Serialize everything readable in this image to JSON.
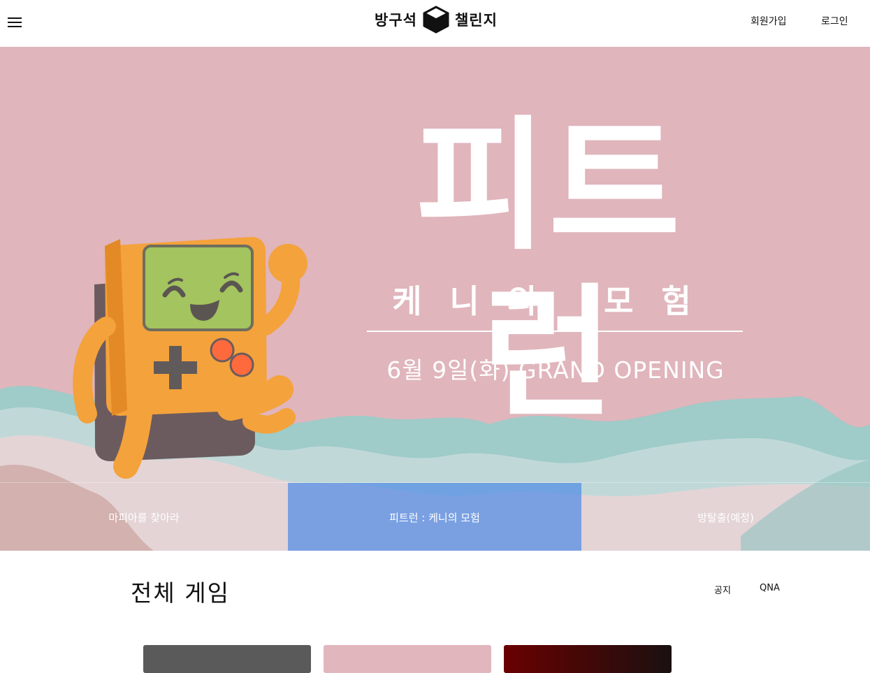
{
  "header": {
    "menu_icon": "hamburger-menu-icon",
    "logo": {
      "left_text": "방구석",
      "right_text": "챌린지",
      "icon": "cube-icon"
    },
    "signup_label": "회원가입",
    "login_label": "로그인"
  },
  "hero": {
    "title": "피트런",
    "subtitle": "케니의 모험",
    "date_text": "6월 9일(화) GRAND OPENING",
    "background_color": "#e0b5bc",
    "character_icon": "gameboy-character-icon",
    "tabs": [
      {
        "label": "마피아를 찾아라",
        "active": false
      },
      {
        "label": "피트런 : 케니의 모험",
        "active": true
      },
      {
        "label": "방탈출(예정)",
        "active": false
      }
    ],
    "active_tab_color": "#508ce6"
  },
  "section": {
    "title": "전체 게임",
    "links": [
      "공지",
      "QNA"
    ]
  }
}
